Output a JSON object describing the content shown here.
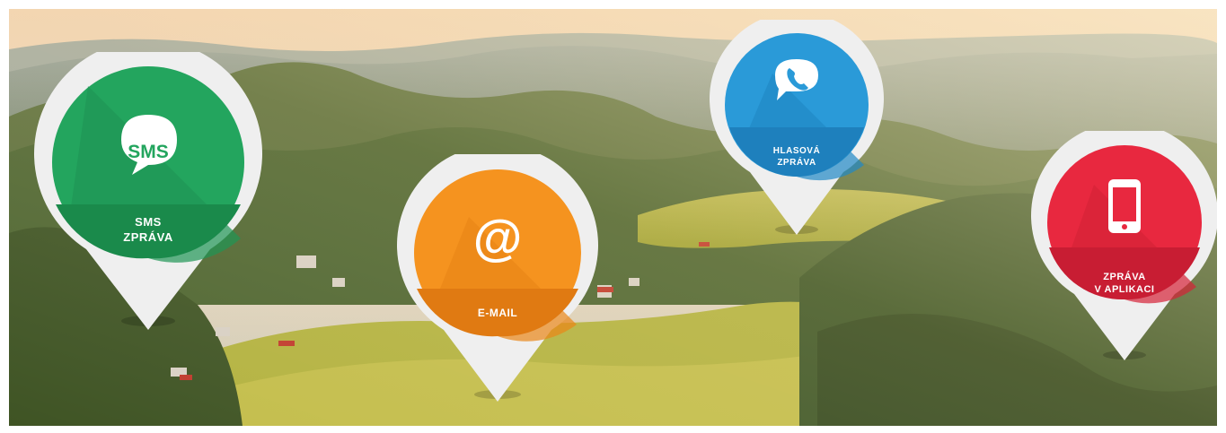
{
  "banner": {
    "scene": "landscape-background"
  },
  "pins": {
    "sms": {
      "label_line1": "SMS",
      "label_line2": "ZPRÁVA",
      "icon_text": "SMS",
      "icon": "speech-bubble-icon",
      "color": "#23a55e",
      "color_dark": "#1a8a4b"
    },
    "email": {
      "label_line1": "E-MAIL",
      "icon_text": "@",
      "icon": "at-sign-icon",
      "color": "#f5931f",
      "color_dark": "#e07a12"
    },
    "voice": {
      "label_line1": "HLASOVÁ",
      "label_line2": "ZPRÁVA",
      "icon": "phone-bubble-icon",
      "color": "#2a9ad8",
      "color_dark": "#1e80bd"
    },
    "app": {
      "label_line1": "ZPRÁVA",
      "label_line2": "V APLIKACI",
      "icon": "smartphone-icon",
      "color": "#e8283f",
      "color_dark": "#c81d33"
    }
  }
}
